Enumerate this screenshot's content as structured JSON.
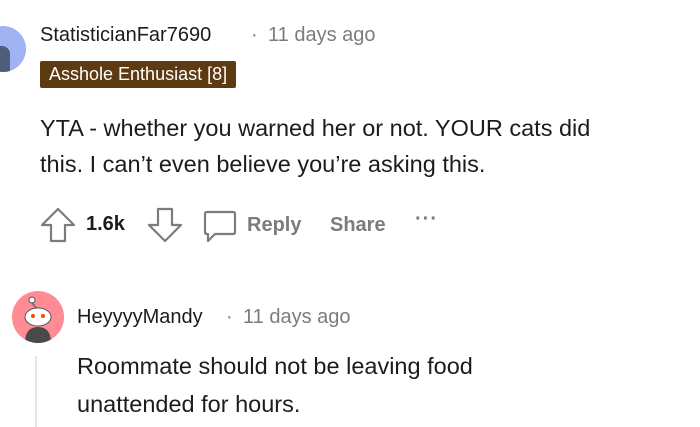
{
  "comments": [
    {
      "username": "StatisticianFar7690",
      "separator": "·",
      "time": "11 days ago",
      "flair": "Asshole Enthusiast [8]",
      "body_lines": [
        "YTA - whether you warned her or not. YOUR cats did",
        "this. I can’t even believe you’re asking this."
      ],
      "score": "1.6k",
      "actions": {
        "reply": "Reply",
        "share": "Share",
        "more": "···"
      },
      "avatar_color": "#9fb3f2"
    },
    {
      "username": "HeyyyyMandy",
      "separator": "·",
      "time": "11 days ago",
      "body_lines": [
        "Roommate should not be leaving food",
        "unattended for hours."
      ],
      "avatar_color": "#ff8c95"
    }
  ],
  "colors": {
    "text": "#1c1c1c",
    "meta": "#7c7c7c",
    "flair_bg": "#5e3a12",
    "flair_text": "#ffffff",
    "thread_line": "#e5e5e5"
  },
  "icons": [
    "snoo-avatar-icon",
    "upvote-arrow-icon",
    "downvote-arrow-icon",
    "comment-reply-icon",
    "more-options-icon"
  ]
}
